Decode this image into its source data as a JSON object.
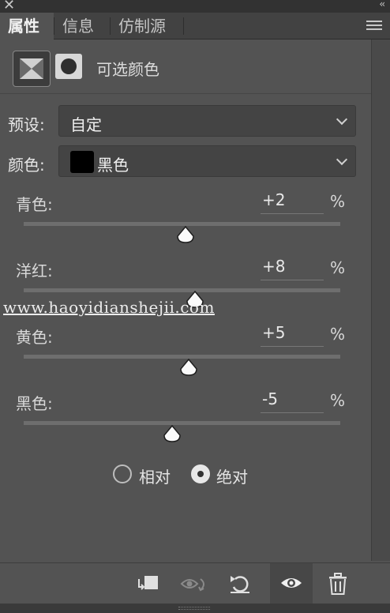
{
  "window": {
    "close_glyph": "✕",
    "collapse_glyph": "‹‹"
  },
  "tabs": [
    {
      "label": "属性",
      "active": true
    },
    {
      "label": "信息",
      "active": false
    },
    {
      "label": "仿制源",
      "active": false
    }
  ],
  "header": {
    "title": "可选颜色"
  },
  "preset": {
    "label": "预设:",
    "value": "自定"
  },
  "colors": {
    "label": "颜色:",
    "value": "黑色",
    "swatch": "#000000"
  },
  "sliders": [
    {
      "label": "青色:",
      "value": "+2",
      "unit": "%",
      "position": 0.51
    },
    {
      "label": "洋红:",
      "value": "+8",
      "unit": "%",
      "position": 0.54
    },
    {
      "label": "黄色:",
      "value": "+5",
      "unit": "%",
      "position": 0.52
    },
    {
      "label": "黑色:",
      "value": "-5",
      "unit": "%",
      "position": 0.47
    }
  ],
  "method": {
    "options": [
      {
        "label": "相对",
        "selected": false
      },
      {
        "label": "绝对",
        "selected": true
      }
    ]
  },
  "watermark": "www.haoyidianshejii.com",
  "bottom_icons": [
    "clip-to-layer-icon",
    "view-previous-icon",
    "reset-icon",
    "visibility-eye-icon",
    "trash-icon"
  ],
  "colors_theme": {
    "panel": "#535353",
    "tabbar": "#424242",
    "field": "#444444"
  }
}
